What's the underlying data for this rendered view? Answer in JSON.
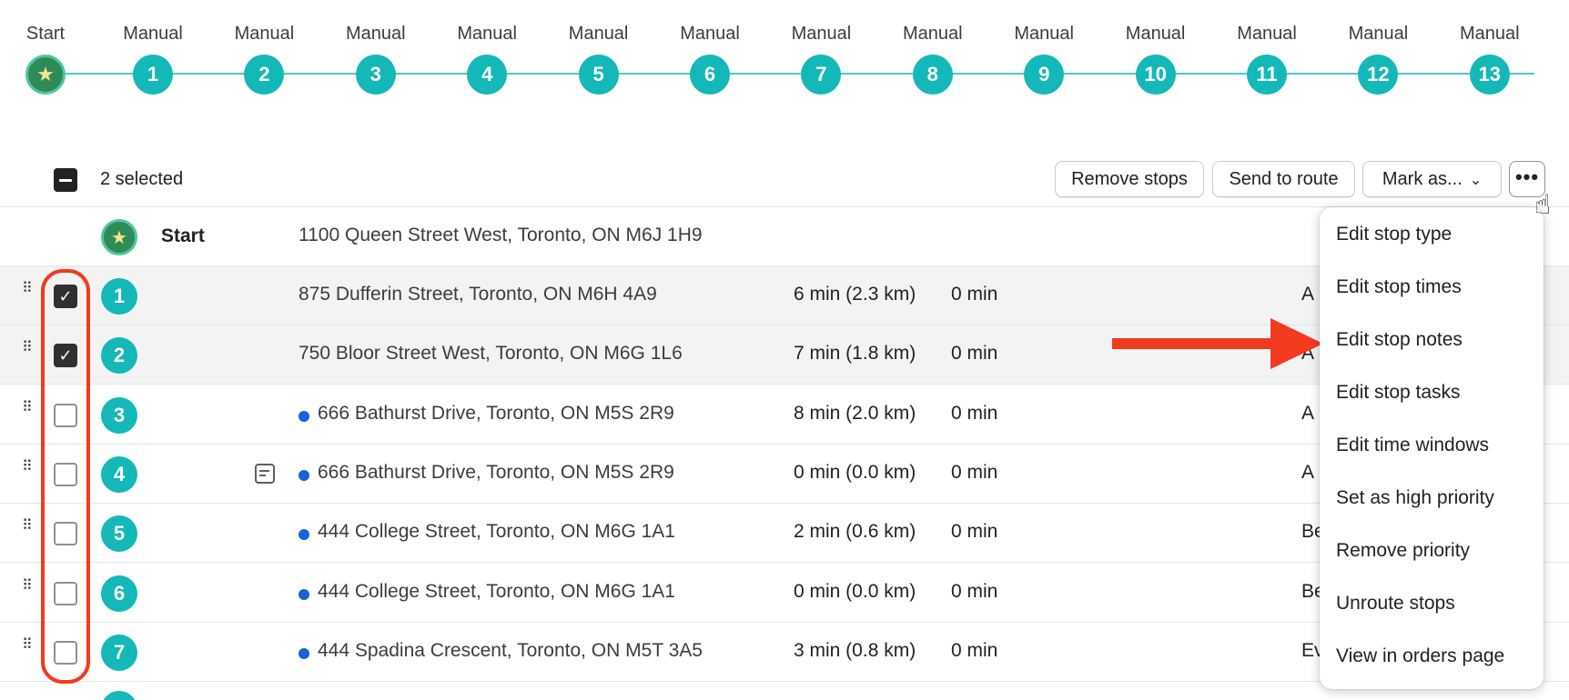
{
  "timeline": {
    "start_label": "Start",
    "nodes": [
      {
        "label": "Manual",
        "num": "1"
      },
      {
        "label": "Manual",
        "num": "2"
      },
      {
        "label": "Manual",
        "num": "3"
      },
      {
        "label": "Manual",
        "num": "4"
      },
      {
        "label": "Manual",
        "num": "5"
      },
      {
        "label": "Manual",
        "num": "6"
      },
      {
        "label": "Manual",
        "num": "7"
      },
      {
        "label": "Manual",
        "num": "8"
      },
      {
        "label": "Manual",
        "num": "9"
      },
      {
        "label": "Manual",
        "num": "10"
      },
      {
        "label": "Manual",
        "num": "11"
      },
      {
        "label": "Manual",
        "num": "12"
      },
      {
        "label": "Manual",
        "num": "13"
      }
    ]
  },
  "toolbar": {
    "selected_count": "2 selected",
    "remove_label": "Remove stops",
    "send_label": "Send to route",
    "mark_label": "Mark as...",
    "more_label": "•••"
  },
  "start_row": {
    "name": "Start",
    "address": "1100 Queen Street West, Toronto, ON M6J 1H9"
  },
  "stops": [
    {
      "num": "1",
      "address": "875 Dufferin Street, Toronto, ON M6H 4A9",
      "dist": "6 min (2.3 km)",
      "svc": "0 min",
      "trunc": "A",
      "checked": true,
      "dot": false,
      "note": false
    },
    {
      "num": "2",
      "address": "750 Bloor Street West, Toronto, ON M6G 1L6",
      "dist": "7 min (1.8 km)",
      "svc": "0 min",
      "trunc": "A",
      "checked": true,
      "dot": false,
      "note": false
    },
    {
      "num": "3",
      "address": "666 Bathurst Drive, Toronto, ON M5S 2R9",
      "dist": "8 min (2.0 km)",
      "svc": "0 min",
      "trunc": "A",
      "checked": false,
      "dot": true,
      "note": false
    },
    {
      "num": "4",
      "address": "666 Bathurst Drive, Toronto, ON M5S 2R9",
      "dist": "0 min (0.0 km)",
      "svc": "0 min",
      "trunc": "A",
      "checked": false,
      "dot": true,
      "note": true
    },
    {
      "num": "5",
      "address": "444 College Street, Toronto, ON M6G 1A1",
      "dist": "2 min (0.6 km)",
      "svc": "0 min",
      "trunc": "Be",
      "checked": false,
      "dot": true,
      "note": false
    },
    {
      "num": "6",
      "address": "444 College Street, Toronto, ON M6G 1A1",
      "dist": "0 min (0.0 km)",
      "svc": "0 min",
      "trunc": "Be",
      "checked": false,
      "dot": true,
      "note": false
    },
    {
      "num": "7",
      "address": "444 Spadina Crescent, Toronto, ON M5T 3A5",
      "dist": "3 min (0.8 km)",
      "svc": "0 min",
      "trunc": "Ev",
      "checked": false,
      "dot": true,
      "note": false
    }
  ],
  "menu": {
    "items": [
      "Edit stop type",
      "Edit stop times",
      "Edit stop notes",
      "Edit stop tasks",
      "Edit time windows",
      "Set as high priority",
      "Remove priority",
      "Unroute stops",
      "View in orders page"
    ]
  },
  "colors": {
    "teal": "#14b8b8",
    "start_green": "#2e8b57",
    "annotation_red": "#f23a1e",
    "dot_blue": "#1565d8"
  }
}
